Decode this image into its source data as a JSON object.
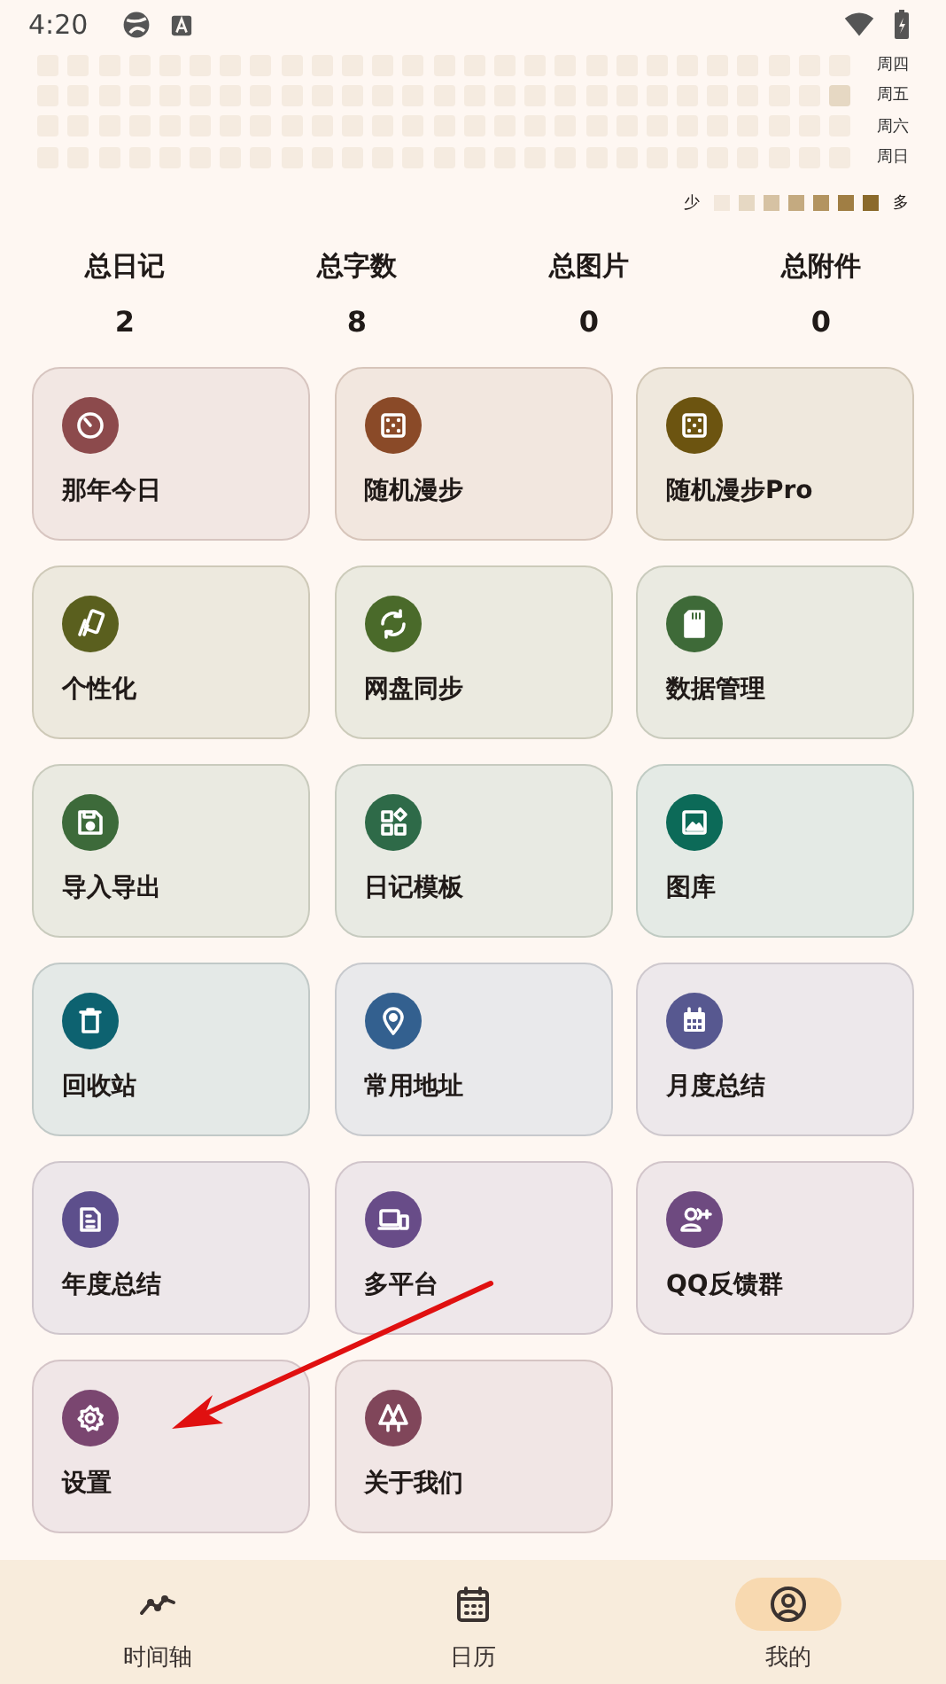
{
  "status_bar": {
    "time": "4:20"
  },
  "heatmap": {
    "rows": [
      {
        "label": "周四",
        "cells": [
          {
            "color": "#f5ebe0"
          },
          {
            "color": "#f5ebe0"
          },
          {
            "color": "#f5ebe0"
          },
          {
            "color": "#f5ebe0"
          },
          {
            "color": "#f5ebe0"
          },
          {
            "color": "#f5ebe0"
          },
          {
            "color": "#f5ebe0"
          },
          {
            "color": "#f5ebe0"
          },
          {
            "color": "#f5ebe0"
          },
          {
            "color": "#f5ebe0"
          },
          {
            "color": "#f5ebe0"
          },
          {
            "color": "#f5ebe0"
          },
          {
            "color": "#f5ebe0"
          },
          {
            "color": "#f5ebe0"
          },
          {
            "color": "#f5ebe0"
          },
          {
            "color": "#f5ebe0"
          },
          {
            "color": "#f5ebe0"
          },
          {
            "color": "#f5ebe0"
          },
          {
            "color": "#f5ebe0"
          },
          {
            "color": "#f5ebe0"
          },
          {
            "color": "#f5ebe0"
          },
          {
            "color": "#f5ebe0"
          },
          {
            "color": "#f5ebe0"
          },
          {
            "color": "#f5ebe0"
          },
          {
            "color": "#f5ebe0"
          },
          {
            "color": "#f5ebe0"
          },
          {
            "color": "#f5ebe0"
          }
        ]
      },
      {
        "label": "周五",
        "cells": [
          {
            "color": "#f5ebe0"
          },
          {
            "color": "#f5ebe0"
          },
          {
            "color": "#f5ebe0"
          },
          {
            "color": "#f5ebe0"
          },
          {
            "color": "#f5ebe0"
          },
          {
            "color": "#f5ebe0"
          },
          {
            "color": "#f5ebe0"
          },
          {
            "color": "#f5ebe0"
          },
          {
            "color": "#f5ebe0"
          },
          {
            "color": "#f5ebe0"
          },
          {
            "color": "#f5ebe0"
          },
          {
            "color": "#f5ebe0"
          },
          {
            "color": "#f5ebe0"
          },
          {
            "color": "#f5ebe0"
          },
          {
            "color": "#f5ebe0"
          },
          {
            "color": "#f5ebe0"
          },
          {
            "color": "#f5ebe0"
          },
          {
            "color": "#f5ebe0"
          },
          {
            "color": "#f5ebe0"
          },
          {
            "color": "#f5ebe0"
          },
          {
            "color": "#f5ebe0"
          },
          {
            "color": "#f5ebe0"
          },
          {
            "color": "#f5ebe0"
          },
          {
            "color": "#f5ebe0"
          },
          {
            "color": "#f5ebe0"
          },
          {
            "color": "#f5ebe0"
          },
          {
            "color": "#e6d8c3"
          }
        ]
      },
      {
        "label": "周六",
        "cells": [
          {
            "color": "#f5ebe0"
          },
          {
            "color": "#f5ebe0"
          },
          {
            "color": "#f5ebe0"
          },
          {
            "color": "#f5ebe0"
          },
          {
            "color": "#f5ebe0"
          },
          {
            "color": "#f5ebe0"
          },
          {
            "color": "#f5ebe0"
          },
          {
            "color": "#f5ebe0"
          },
          {
            "color": "#f5ebe0"
          },
          {
            "color": "#f5ebe0"
          },
          {
            "color": "#f5ebe0"
          },
          {
            "color": "#f5ebe0"
          },
          {
            "color": "#f5ebe0"
          },
          {
            "color": "#f5ebe0"
          },
          {
            "color": "#f5ebe0"
          },
          {
            "color": "#f5ebe0"
          },
          {
            "color": "#f5ebe0"
          },
          {
            "color": "#f5ebe0"
          },
          {
            "color": "#f5ebe0"
          },
          {
            "color": "#f5ebe0"
          },
          {
            "color": "#f5ebe0"
          },
          {
            "color": "#f5ebe0"
          },
          {
            "color": "#f5ebe0"
          },
          {
            "color": "#f5ebe0"
          },
          {
            "color": "#f5ebe0"
          },
          {
            "color": "#f5ebe0"
          },
          {
            "color": "#f5ebe0"
          }
        ]
      },
      {
        "label": "周日",
        "cells": [
          {
            "color": "#f5ebe0"
          },
          {
            "color": "#f5ebe0"
          },
          {
            "color": "#f5ebe0"
          },
          {
            "color": "#f5ebe0"
          },
          {
            "color": "#f5ebe0"
          },
          {
            "color": "#f5ebe0"
          },
          {
            "color": "#f5ebe0"
          },
          {
            "color": "#f5ebe0"
          },
          {
            "color": "#f5ebe0"
          },
          {
            "color": "#f5ebe0"
          },
          {
            "color": "#f5ebe0"
          },
          {
            "color": "#f5ebe0"
          },
          {
            "color": "#f5ebe0"
          },
          {
            "color": "#f5ebe0"
          },
          {
            "color": "#f5ebe0"
          },
          {
            "color": "#f5ebe0"
          },
          {
            "color": "#f5ebe0"
          },
          {
            "color": "#f5ebe0"
          },
          {
            "color": "#f5ebe0"
          },
          {
            "color": "#f5ebe0"
          },
          {
            "color": "#f5ebe0"
          },
          {
            "color": "#f5ebe0"
          },
          {
            "color": "#f5ebe0"
          },
          {
            "color": "#f5ebe0"
          },
          {
            "color": "#f5ebe0"
          },
          {
            "color": "#f5ebe0"
          },
          {
            "color": "#f5ebe0"
          }
        ]
      }
    ],
    "legend": {
      "low": "少",
      "high": "多",
      "steps": [
        {
          "color": "#f3e8dc"
        },
        {
          "color": "#e6d8c3"
        },
        {
          "color": "#d6c2a3"
        },
        {
          "color": "#c4aa80"
        },
        {
          "color": "#b39460"
        },
        {
          "color": "#a07e44"
        },
        {
          "color": "#8b6a2b"
        }
      ]
    }
  },
  "stats": [
    {
      "label": "总日记",
      "value": "2"
    },
    {
      "label": "总字数",
      "value": "8"
    },
    {
      "label": "总图片",
      "value": "0"
    },
    {
      "label": "总附件",
      "value": "0"
    }
  ],
  "features": [
    {
      "label": "那年今日",
      "kind": "timer",
      "color": "#8c4a4c"
    },
    {
      "label": "随机漫步",
      "kind": "dice",
      "color": "#8a4a28"
    },
    {
      "label": "随机漫步Pro",
      "kind": "dice",
      "color": "#6c5410"
    },
    {
      "label": "个性化",
      "kind": "cards",
      "color": "#5a5f1e"
    },
    {
      "label": "网盘同步",
      "kind": "sync",
      "color": "#4a6a2a"
    },
    {
      "label": "数据管理",
      "kind": "sdcard",
      "color": "#3e6a38"
    },
    {
      "label": "导入导出",
      "kind": "save",
      "color": "#3d6a3a"
    },
    {
      "label": "日记模板",
      "kind": "widgets",
      "color": "#2e6a48"
    },
    {
      "label": "图库",
      "kind": "image",
      "color": "#0c6a58"
    },
    {
      "label": "回收站",
      "kind": "trash",
      "color": "#0d6270"
    },
    {
      "label": "常用地址",
      "kind": "pin",
      "color": "#33608f"
    },
    {
      "label": "月度总结",
      "kind": "calendar",
      "color": "#575890"
    },
    {
      "label": "年度总结",
      "kind": "document",
      "color": "#5d4f8c"
    },
    {
      "label": "多平台",
      "kind": "devices",
      "color": "#684c88"
    },
    {
      "label": "QQ反馈群",
      "kind": "group",
      "color": "#6e4a80"
    },
    {
      "label": "设置",
      "kind": "gear",
      "color": "#7a4670"
    },
    {
      "label": "关于我们",
      "kind": "trees",
      "color": "#80465a"
    }
  ],
  "annotation": {
    "kind": "arrow"
  },
  "nav": [
    {
      "label": "时间轴",
      "kind": "timeline",
      "selected": false
    },
    {
      "label": "日历",
      "kind": "calendar",
      "selected": false
    },
    {
      "label": "我的",
      "kind": "person",
      "selected": true
    }
  ]
}
